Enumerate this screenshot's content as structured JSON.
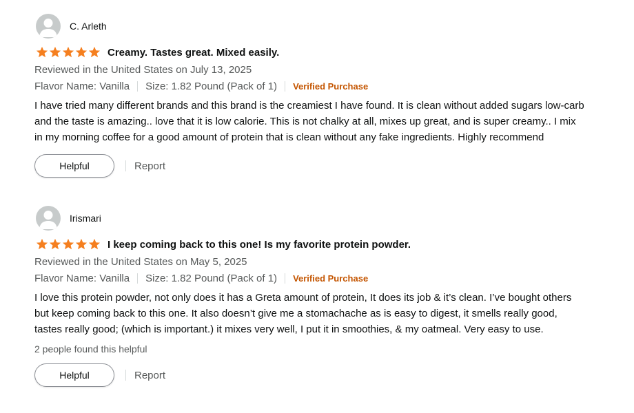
{
  "colors": {
    "star": "#ff9900",
    "verified": "#c45500",
    "muted_text": "#565959"
  },
  "reviews": [
    {
      "reviewer": "C. Arleth",
      "rating": 5,
      "title": "Creamy. Tastes great. Mixed easily.",
      "date": "Reviewed in the United States on July 13, 2025",
      "flavor": "Flavor Name: Vanilla",
      "size": "Size: 1.82 Pound (Pack of 1)",
      "verified": "Verified Purchase",
      "body": "I have tried many different brands and this brand is the creamiest I have found. It is clean without added sugars low-carb and the taste is amazing.. love that it is low calorie. This is not chalky at all, mixes up great, and is super creamy.. I mix in my morning coffee for a good amount of protein that is clean without any fake ingredients. Highly recommend",
      "helpful_label": "Helpful",
      "report_label": "Report"
    },
    {
      "reviewer": "Irismari",
      "rating": 5,
      "title": "I keep coming back to this one! Is my favorite protein powder.",
      "date": "Reviewed in the United States on May 5, 2025",
      "flavor": "Flavor Name: Vanilla",
      "size": "Size: 1.82 Pound (Pack of 1)",
      "verified": "Verified Purchase",
      "body": "I love this protein powder, not only does it has a Greta amount of protein, It does its job & it’s clean. I’ve bought others but keep coming back to this one. It also doesn’t give me a stomachache as is easy to digest, it smells really good, tastes really good; (which is important.) it mixes very well, I put it in smoothies, & my oatmeal. Very easy to use.",
      "helpful_count": "2 people found this helpful",
      "helpful_label": "Helpful",
      "report_label": "Report"
    }
  ]
}
